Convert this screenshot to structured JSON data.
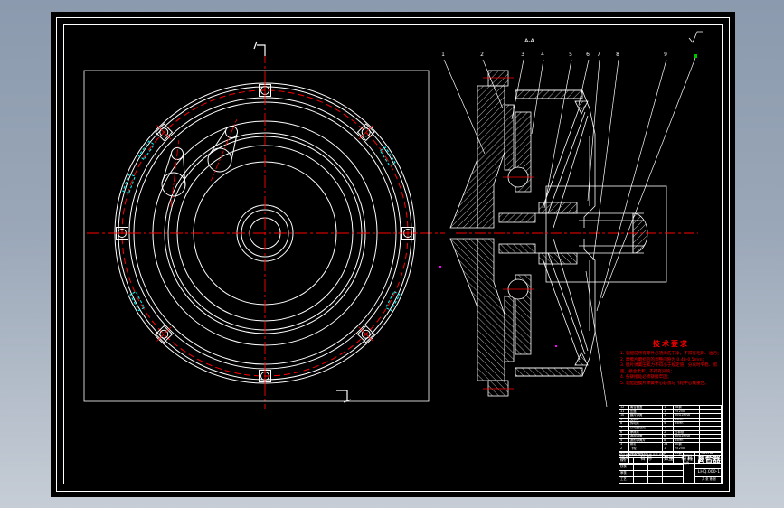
{
  "app": {
    "background_top": "#8b9aae",
    "background_bottom": "#c6cdd6",
    "sheet_color": "#000000",
    "line_color": "#ffffff",
    "centerline_color": "#ff0000",
    "highlight_cyan": "#00ffff",
    "marker_green": "#00c000",
    "marker_magenta": "#ff00ff"
  },
  "drawing": {
    "section_label": "A-A",
    "balloons": [
      "1",
      "2",
      "3",
      "4",
      "5",
      "6",
      "7",
      "8",
      "9"
    ],
    "tech": {
      "title": "技术要求",
      "items": [
        "1. 装配前所有零件必须清洗干净，不得有毛刺、油污；",
        "2. 摩擦片磨损后的调整间隙为 0.48-0.5mm；",
        "3. 膜片弹簧压紧力不得小于规定值，分离时平稳、彻底，接合柔和，不得有异响；",
        "4. 各铆接处必须铆接牢固；",
        "5. 装配后膜片弹簧中心必须与飞轮中心线重合。"
      ]
    },
    "title_block": {
      "part_name": "离合器",
      "drawing_no": "LHQ.000-1",
      "change_strip": "标记 处数 分区 更改文件号 签字 日期",
      "left_rows": [
        [
          "设计",
          "",
          ""
        ],
        [
          "校核",
          "",
          ""
        ],
        [
          "审核",
          "",
          ""
        ],
        [
          "工艺",
          "",
          ""
        ]
      ],
      "mid_labels": "阶段标记 重量 比例",
      "sheet_info": "共 张 第 张",
      "bom_headers": [
        "序号",
        "名 称",
        "数量",
        "材 料",
        "备 注"
      ],
      "bom_rows": [
        [
          "12",
          "离合器盖",
          "1",
          "08钢",
          ""
        ],
        [
          "11",
          "压盘",
          "1",
          "HT250",
          ""
        ],
        [
          "10",
          "膜片弹簧",
          "1",
          "60Si2MnA",
          ""
        ],
        [
          "9",
          "支承环",
          "2",
          "65Mn",
          ""
        ],
        [
          "8",
          "传动片",
          "4",
          "65Mn",
          ""
        ],
        [
          "7",
          "从动盘总成",
          "1",
          "",
          ""
        ],
        [
          "6",
          "摩擦片",
          "2",
          "石棉基",
          ""
        ],
        [
          "5",
          "减振弹簧",
          "6",
          "60Si2MnA",
          ""
        ],
        [
          "4",
          "波形弹簧片",
          "8",
          "65Mn",
          ""
        ],
        [
          "3",
          "铆钉",
          "24",
          "10钢",
          ""
        ],
        [
          "2",
          "飞轮",
          "1",
          "HT250",
          ""
        ],
        [
          "1",
          "螺栓M8×20",
          "6",
          "35钢",
          "GB5782"
        ]
      ]
    }
  }
}
